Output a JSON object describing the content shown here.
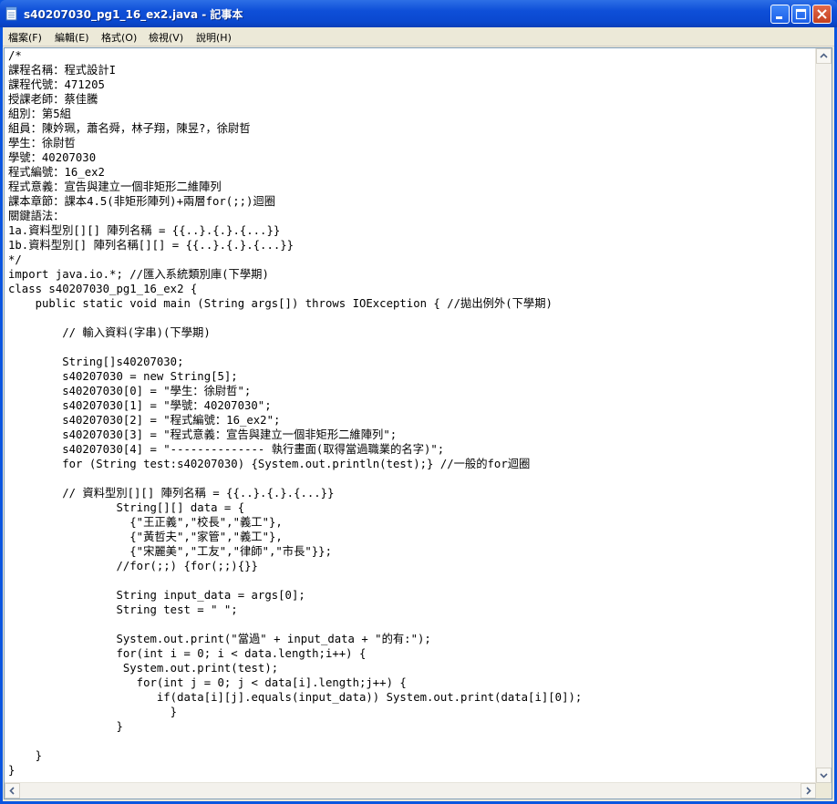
{
  "window": {
    "title": "s40207030_pg1_16_ex2.java - 記事本"
  },
  "menu": [
    {
      "label": "檔案(F)"
    },
    {
      "label": "編輯(E)"
    },
    {
      "label": "格式(O)"
    },
    {
      "label": "檢視(V)"
    },
    {
      "label": "說明(H)"
    }
  ],
  "editor": {
    "lines": [
      "/*",
      "課程名稱：程式設計I",
      "課程代號：471205",
      "授課老師：蔡佳騰",
      "組別：第5組",
      "組員：陳妗珮，蕭名舜，林子翔，陳昱?，徐尉哲",
      "學生：徐尉哲",
      "學號：40207030",
      "程式編號：16_ex2",
      "程式意義：宣告與建立一個非矩形二維陣列",
      "課本章節：課本4.5(非矩形陣列)+兩層for(;;)迴圈",
      "關鍵語法：",
      "1a.資料型別[][] 陣列名稱 = {{..}.{.}.{...}}",
      "1b.資料型別[] 陣列名稱[][] = {{..}.{.}.{...}}",
      "*/",
      "import java.io.*; //匯入系統類別庫(下學期)",
      "class s40207030_pg1_16_ex2 {",
      "    public static void main (String args[]) throws IOException { //拋出例外(下學期)",
      "",
      "        // 輸入資料(字串)(下學期)",
      "",
      "        String[]s40207030;",
      "        s40207030 = new String[5];",
      "        s40207030[0] = \"學生：徐尉哲\";",
      "        s40207030[1] = \"學號：40207030\";",
      "        s40207030[2] = \"程式編號：16_ex2\";",
      "        s40207030[3] = \"程式意義：宣告與建立一個非矩形二維陣列\";",
      "        s40207030[4] = \"-------------- 執行畫面(取得當過職業的名字)\";",
      "        for (String test:s40207030) {System.out.println(test);} //一般的for迴圈",
      "",
      "        // 資料型別[][] 陣列名稱 = {{..}.{.}.{...}}",
      "                String[][] data = {",
      "                  {\"王正義\",\"校長\",\"義工\"},",
      "                  {\"黃哲夫\",\"家管\",\"義工\"},",
      "                  {\"宋麗美\",\"工友\",\"律師\",\"市長\"}};",
      "                //for(;;) {for(;;){}}",
      "",
      "                String input_data = args[0];",
      "                String test = \" \";",
      "",
      "                System.out.print(\"當過\" + input_data + \"的有:\");",
      "                for(int i = 0; i < data.length;i++) {",
      "                 System.out.print(test);",
      "                   for(int j = 0; j < data[i].length;j++) {",
      "                      if(data[i][j].equals(input_data)) System.out.print(data[i][0]);",
      "                        }",
      "                }",
      "",
      "    }",
      "}"
    ]
  },
  "colors": {
    "titlebar": "#0a48cf",
    "frame": "#ece9d8",
    "close": "#c4401f"
  },
  "icons": [
    "notepad-icon",
    "minimize-icon",
    "maximize-icon",
    "close-icon",
    "arrow-up-icon",
    "arrow-down-icon",
    "arrow-left-icon",
    "arrow-right-icon"
  ]
}
